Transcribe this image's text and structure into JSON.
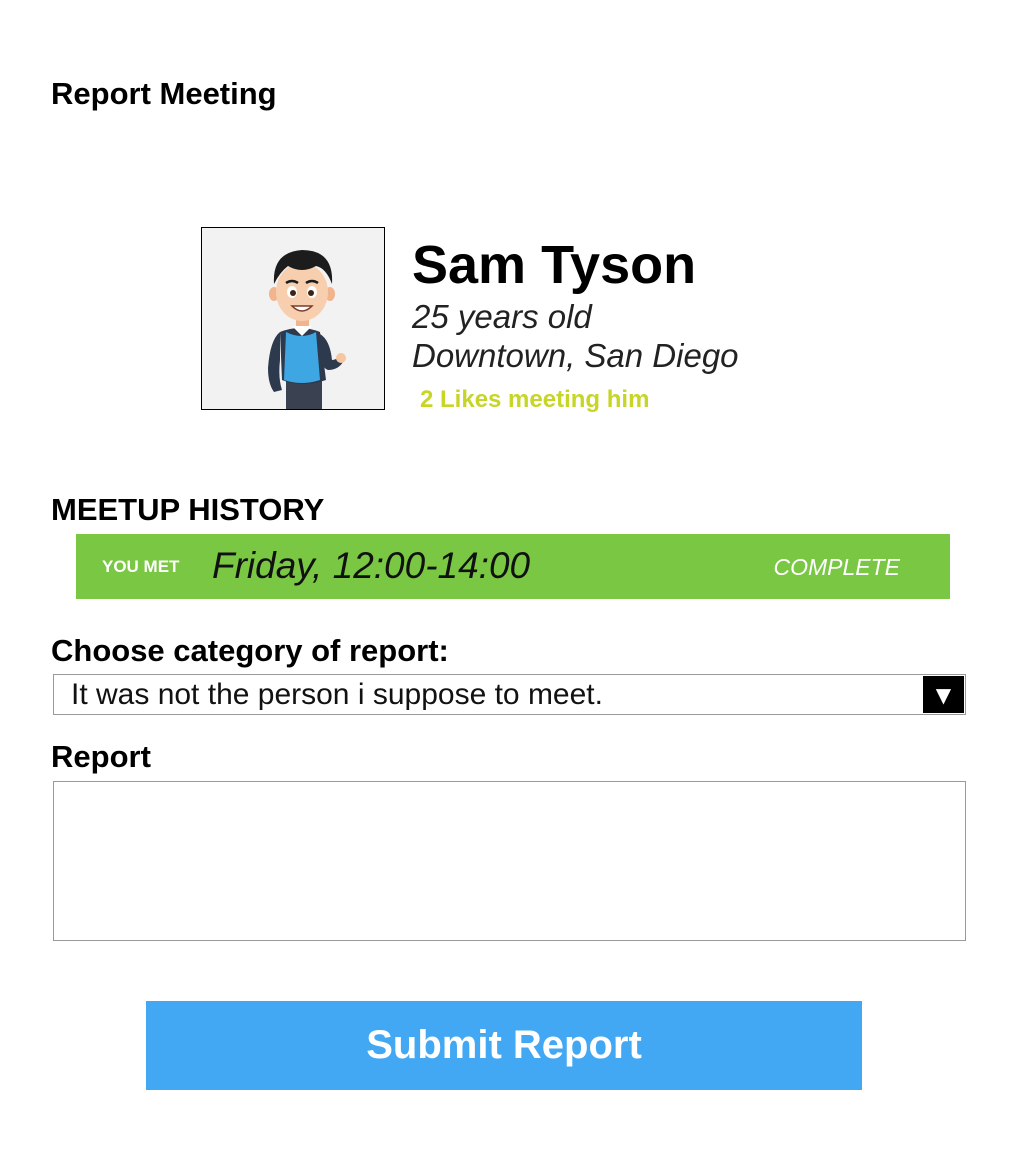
{
  "page": {
    "title": "Report Meeting"
  },
  "profile": {
    "name": "Sam Tyson",
    "age": "25 years old",
    "location": "Downtown, San Diego",
    "likes": "2 Likes meeting him",
    "avatar_icon": "cartoon-man-avatar"
  },
  "meetup_history": {
    "heading": "MEETUP HISTORY",
    "entries": [
      {
        "label": "YOU MET",
        "time": "Friday, 12:00-14:00",
        "status": "COMPLETE"
      }
    ]
  },
  "report_form": {
    "category_label": "Choose category of report:",
    "category_selected": "It was not the person i suppose to meet.",
    "dropdown_icon": "triangle-down",
    "report_label": "Report",
    "report_value": "",
    "submit_label": "Submit Report"
  },
  "colors": {
    "meetup_row": "#79c743",
    "likes_text": "#c7d626",
    "submit_button": "#42a8f4"
  }
}
